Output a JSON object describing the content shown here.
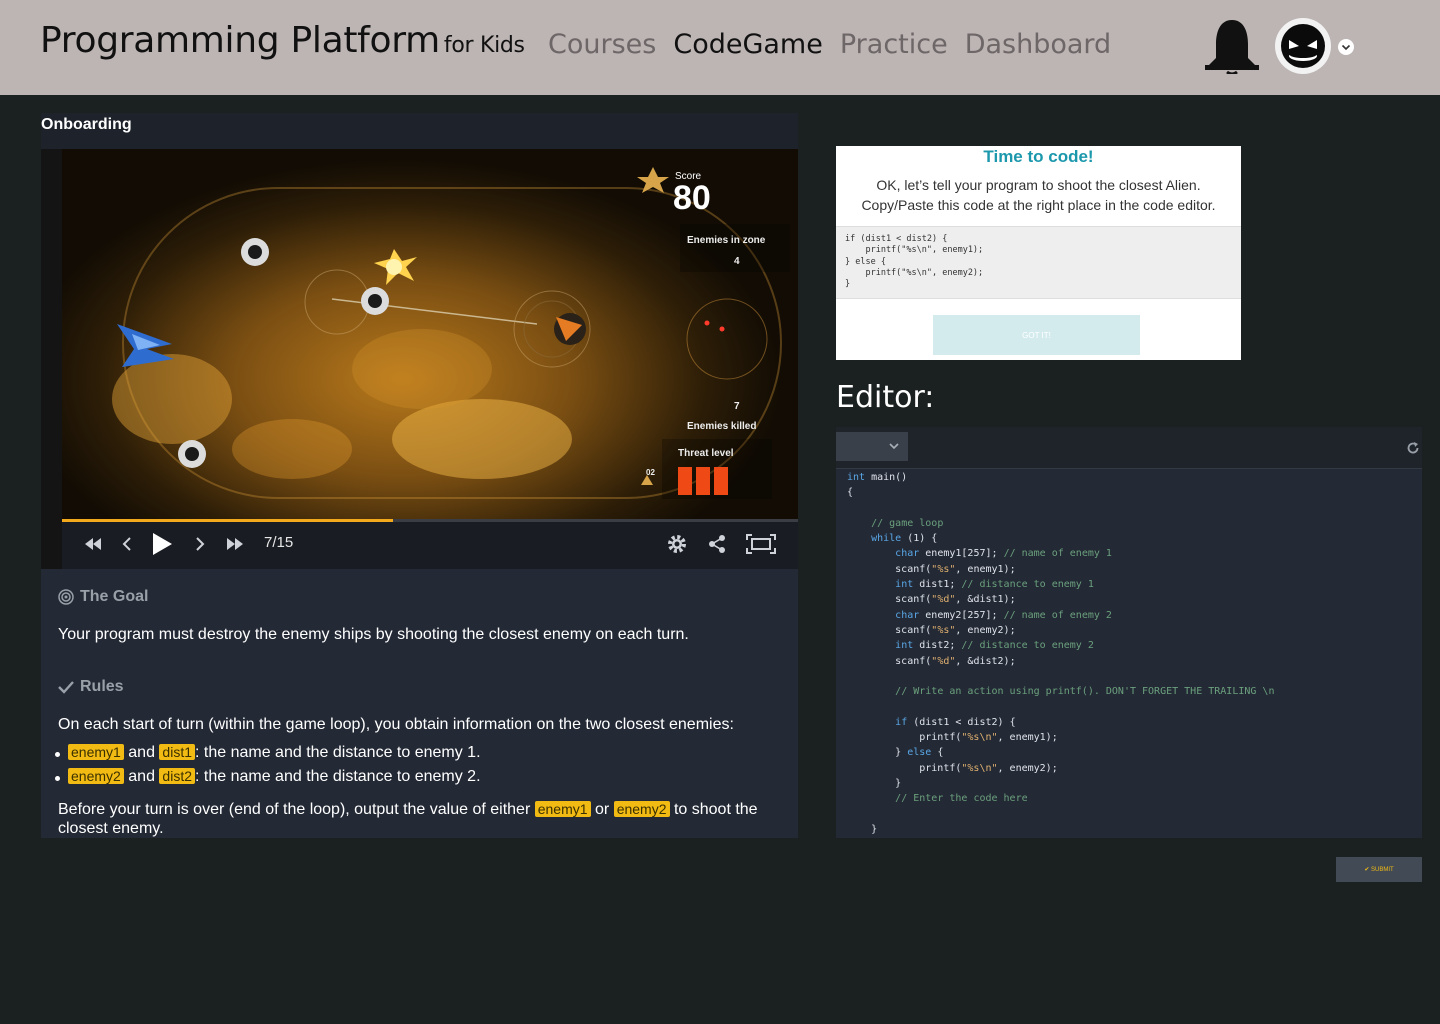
{
  "header": {
    "brand": "Programming Platform",
    "brand_sub": "for Kids",
    "nav": [
      "Courses",
      "CodeGame",
      "Practice",
      "Dashboard"
    ],
    "active_nav": "CodeGame",
    "icons": {
      "notifications": "bell-icon",
      "avatar": "avatar-icon",
      "menu": "chevron-down-icon"
    }
  },
  "onboarding": {
    "title": "Onboarding",
    "game": {
      "score_label": "Score",
      "score": "80",
      "enemies_in_zone_label": "Enemies in zone",
      "enemies_in_zone": "4",
      "enemies_killed": "7",
      "enemies_killed_label": "Enemies killed",
      "threat_label": "Threat level",
      "threat_code": "02",
      "frame": "7/15",
      "progress": 0.45
    },
    "goal": {
      "heading": "The Goal",
      "text": "Your program must destroy the enemy ships by shooting the closest enemy on each turn."
    },
    "rules": {
      "heading": "Rules",
      "intro": "On each start of turn (within the game loop), you obtain information on the two closest enemies:",
      "items": [
        {
          "var1": "enemy1",
          "joiner": "and",
          "var2": "dist1",
          "text": ": the name and the distance to enemy 1."
        },
        {
          "var1": "enemy2",
          "joiner": "and",
          "var2": "dist2",
          "text": ": the name and the distance to enemy 2."
        }
      ],
      "outro_1": "Before your turn is over (end of the loop), output the value of either",
      "outro_var1": "enemy1",
      "outro_or": "or",
      "outro_var2": "enemy2",
      "outro_2": "to shoot the",
      "outro_3": "closest enemy."
    }
  },
  "popup": {
    "title": "Time to code!",
    "line1": "OK, let’s tell your program to shoot the closest Alien.",
    "line2": "Copy/Paste this code at the right place in the code editor.",
    "code": "if (dist1 < dist2) {\n    printf(\"%s\\n\", enemy1);\n} else {\n    printf(\"%s\\n\", enemy2);\n}",
    "button": "GOT IT!"
  },
  "editor": {
    "title": "Editor:",
    "submit": "SUBMIT",
    "reset_icon": "reset-icon"
  }
}
